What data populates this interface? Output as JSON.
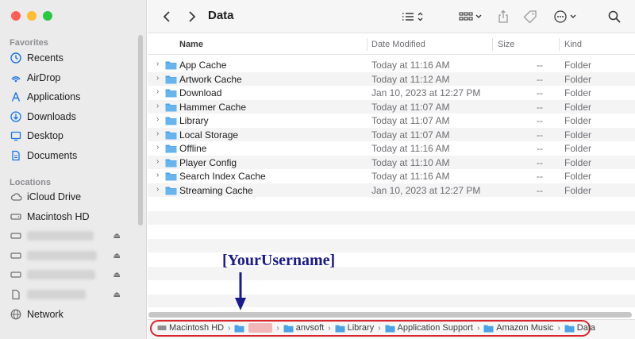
{
  "window": {
    "title": "Data"
  },
  "sidebar": {
    "favorites_heading": "Favorites",
    "favorites": [
      {
        "label": "Recents",
        "icon": "clock-icon"
      },
      {
        "label": "AirDrop",
        "icon": "airdrop-icon"
      },
      {
        "label": "Applications",
        "icon": "applications-icon"
      },
      {
        "label": "Downloads",
        "icon": "download-icon"
      },
      {
        "label": "Desktop",
        "icon": "desktop-icon"
      },
      {
        "label": "Documents",
        "icon": "document-icon"
      }
    ],
    "locations_heading": "Locations",
    "locations": [
      {
        "label": "iCloud Drive",
        "icon": "cloud-icon"
      },
      {
        "label": "Macintosh HD",
        "icon": "disk-icon"
      },
      {
        "label": "Network",
        "icon": "globe-icon"
      }
    ]
  },
  "columns": {
    "name": "Name",
    "date": "Date Modified",
    "size": "Size",
    "kind": "Kind"
  },
  "files": [
    {
      "name": "App Cache",
      "date": "Today at 11:16 AM",
      "size": "--",
      "kind": "Folder"
    },
    {
      "name": "Artwork Cache",
      "date": "Today at 11:12 AM",
      "size": "--",
      "kind": "Folder"
    },
    {
      "name": "Download",
      "date": "Jan 10, 2023 at 12:27 PM",
      "size": "--",
      "kind": "Folder"
    },
    {
      "name": "Hammer Cache",
      "date": "Today at 11:07 AM",
      "size": "--",
      "kind": "Folder"
    },
    {
      "name": "Library",
      "date": "Today at 11:07 AM",
      "size": "--",
      "kind": "Folder"
    },
    {
      "name": "Local Storage",
      "date": "Today at 11:07 AM",
      "size": "--",
      "kind": "Folder"
    },
    {
      "name": "Offline",
      "date": "Today at 11:16 AM",
      "size": "--",
      "kind": "Folder"
    },
    {
      "name": "Player Config",
      "date": "Today at 11:10 AM",
      "size": "--",
      "kind": "Folder"
    },
    {
      "name": "Search Index Cache",
      "date": "Today at 11:16 AM",
      "size": "--",
      "kind": "Folder"
    },
    {
      "name": "Streaming Cache",
      "date": "Jan 10, 2023 at 12:27 PM",
      "size": "--",
      "kind": "Folder"
    }
  ],
  "path": [
    "Macintosh HD",
    "anvsoft",
    "Library",
    "Application Support",
    "Amazon Music",
    "Data"
  ],
  "annotation": {
    "label": "[YourUsername]"
  },
  "colors": {
    "accent": "#1a73e8",
    "folder": "#4aa3e6",
    "highlight": "#d9262c",
    "annotation": "#1a1a8c"
  }
}
